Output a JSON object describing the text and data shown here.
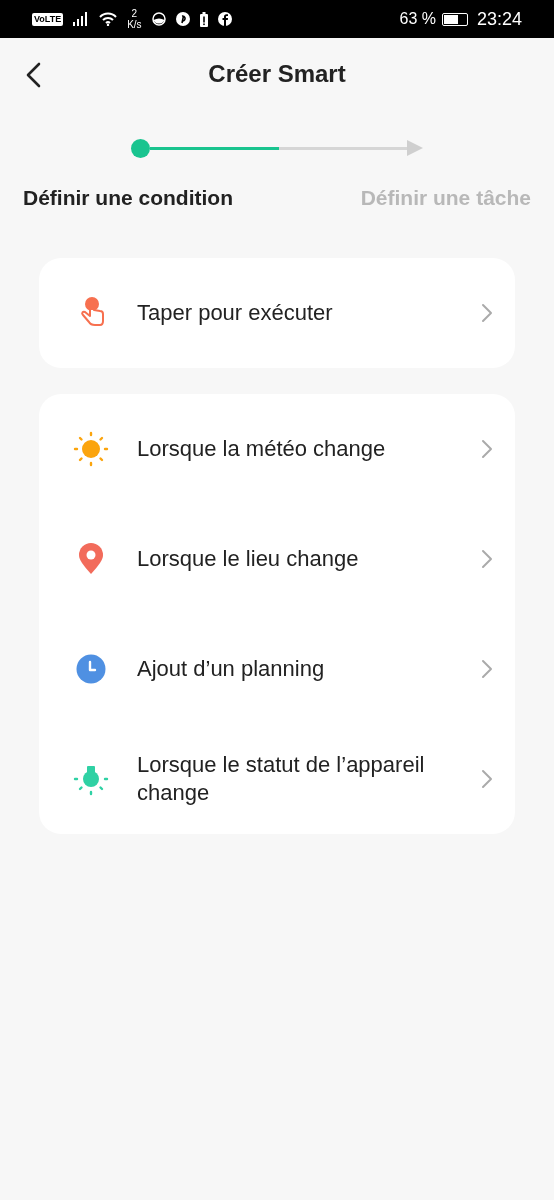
{
  "status_bar": {
    "network_badge": "VoLTE",
    "speed_value": "2",
    "speed_unit": "K/s",
    "battery_percent": "63 %",
    "time": "23:24"
  },
  "header": {
    "title": "Créer Smart"
  },
  "stepper": {
    "level": 0.5,
    "steps": [
      {
        "label": "Définir une condition",
        "selected": true
      },
      {
        "label": "Définir une tâche",
        "selected": false
      }
    ]
  },
  "groups": [
    {
      "items": [
        {
          "kind": "tap",
          "label": "Taper pour exécuter"
        }
      ]
    },
    {
      "items": [
        {
          "kind": "weather",
          "label": "Lorsque la météo change"
        },
        {
          "kind": "location",
          "label": "Lorsque le lieu change"
        },
        {
          "kind": "schedule",
          "label": "Ajout d’un planning"
        },
        {
          "kind": "device",
          "label": "Lorsque le statut de l’appareil change"
        }
      ]
    }
  ]
}
